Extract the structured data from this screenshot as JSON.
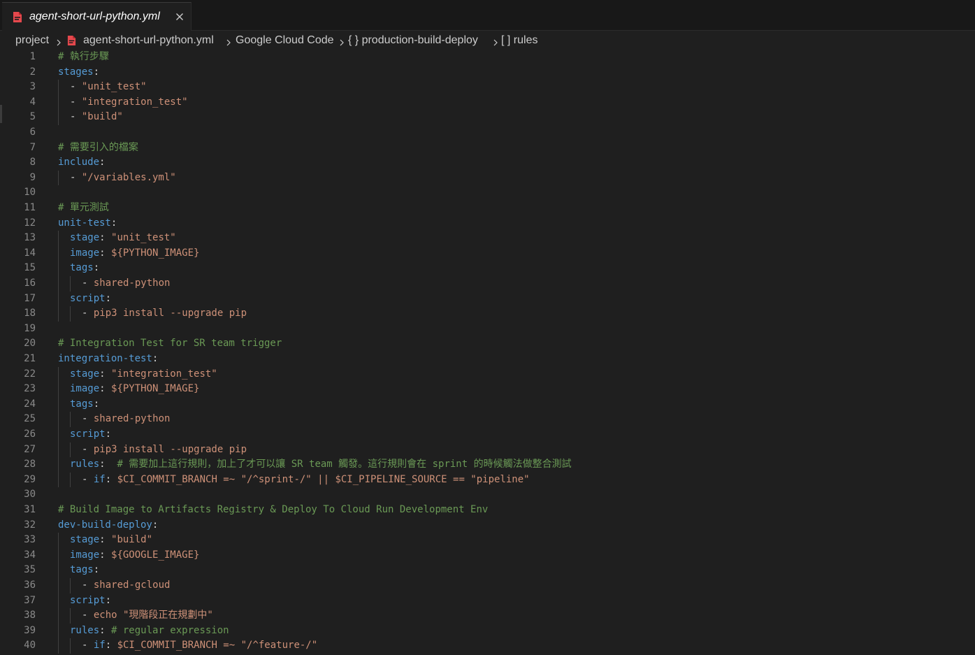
{
  "tab": {
    "title": "agent-short-url-python.yml",
    "icon": "yaml-file-icon",
    "icon_color": "#e5484d"
  },
  "breadcrumb": {
    "items": [
      {
        "label": "project"
      },
      {
        "label": "agent-short-url-python.yml"
      },
      {
        "label": "Google Cloud Code"
      },
      {
        "label": "{ } production-build-deploy"
      },
      {
        "label": "[ ] rules"
      }
    ]
  },
  "colors": {
    "keyword": "#569cd6",
    "string": "#ce9178",
    "comment": "#6a9955",
    "punctuation": "#d4d4d4",
    "line_number": "#8a8a8a"
  },
  "editor": {
    "lines": [
      {
        "n": "1",
        "indent": 0,
        "tokens": [
          {
            "c": "c",
            "t": "# 執行步驟"
          }
        ]
      },
      {
        "n": "2",
        "indent": 0,
        "tokens": [
          {
            "c": "k",
            "t": "stages"
          },
          {
            "c": "p",
            "t": ":"
          }
        ]
      },
      {
        "n": "3",
        "indent": 1,
        "tokens": [
          {
            "c": "p",
            "t": "- "
          },
          {
            "c": "s",
            "t": "\"unit_test\""
          }
        ]
      },
      {
        "n": "4",
        "indent": 1,
        "tokens": [
          {
            "c": "p",
            "t": "- "
          },
          {
            "c": "s",
            "t": "\"integration_test\""
          }
        ]
      },
      {
        "n": "5",
        "indent": 1,
        "tokens": [
          {
            "c": "p",
            "t": "- "
          },
          {
            "c": "s",
            "t": "\"build\""
          }
        ]
      },
      {
        "n": "6",
        "indent": 0,
        "tokens": []
      },
      {
        "n": "7",
        "indent": 0,
        "tokens": [
          {
            "c": "c",
            "t": "# 需要引入的檔案"
          }
        ]
      },
      {
        "n": "8",
        "indent": 0,
        "tokens": [
          {
            "c": "k",
            "t": "include"
          },
          {
            "c": "p",
            "t": ":"
          }
        ]
      },
      {
        "n": "9",
        "indent": 1,
        "tokens": [
          {
            "c": "p",
            "t": "- "
          },
          {
            "c": "s",
            "t": "\"/variables.yml\""
          }
        ]
      },
      {
        "n": "10",
        "indent": 0,
        "tokens": []
      },
      {
        "n": "11",
        "indent": 0,
        "tokens": [
          {
            "c": "c",
            "t": "# 單元測試"
          }
        ]
      },
      {
        "n": "12",
        "indent": 0,
        "tokens": [
          {
            "c": "k",
            "t": "unit-test"
          },
          {
            "c": "p",
            "t": ":"
          }
        ]
      },
      {
        "n": "13",
        "indent": 1,
        "tokens": [
          {
            "c": "k",
            "t": "stage"
          },
          {
            "c": "p",
            "t": ": "
          },
          {
            "c": "s",
            "t": "\"unit_test\""
          }
        ]
      },
      {
        "n": "14",
        "indent": 1,
        "tokens": [
          {
            "c": "k",
            "t": "image"
          },
          {
            "c": "p",
            "t": ": "
          },
          {
            "c": "s",
            "t": "${PYTHON_IMAGE}"
          }
        ]
      },
      {
        "n": "15",
        "indent": 1,
        "tokens": [
          {
            "c": "k",
            "t": "tags"
          },
          {
            "c": "p",
            "t": ":"
          }
        ]
      },
      {
        "n": "16",
        "indent": 2,
        "tokens": [
          {
            "c": "p",
            "t": "- "
          },
          {
            "c": "s",
            "t": "shared-python"
          }
        ]
      },
      {
        "n": "17",
        "indent": 1,
        "tokens": [
          {
            "c": "k",
            "t": "script"
          },
          {
            "c": "p",
            "t": ":"
          }
        ]
      },
      {
        "n": "18",
        "indent": 2,
        "tokens": [
          {
            "c": "p",
            "t": "- "
          },
          {
            "c": "s",
            "t": "pip3 install --upgrade pip"
          }
        ]
      },
      {
        "n": "19",
        "indent": 0,
        "tokens": []
      },
      {
        "n": "20",
        "indent": 0,
        "tokens": [
          {
            "c": "c",
            "t": "# Integration Test for SR team trigger"
          }
        ]
      },
      {
        "n": "21",
        "indent": 0,
        "tokens": [
          {
            "c": "k",
            "t": "integration-test"
          },
          {
            "c": "p",
            "t": ":"
          }
        ]
      },
      {
        "n": "22",
        "indent": 1,
        "tokens": [
          {
            "c": "k",
            "t": "stage"
          },
          {
            "c": "p",
            "t": ": "
          },
          {
            "c": "s",
            "t": "\"integration_test\""
          }
        ]
      },
      {
        "n": "23",
        "indent": 1,
        "tokens": [
          {
            "c": "k",
            "t": "image"
          },
          {
            "c": "p",
            "t": ": "
          },
          {
            "c": "s",
            "t": "${PYTHON_IMAGE}"
          }
        ]
      },
      {
        "n": "24",
        "indent": 1,
        "tokens": [
          {
            "c": "k",
            "t": "tags"
          },
          {
            "c": "p",
            "t": ":"
          }
        ]
      },
      {
        "n": "25",
        "indent": 2,
        "tokens": [
          {
            "c": "p",
            "t": "- "
          },
          {
            "c": "s",
            "t": "shared-python"
          }
        ]
      },
      {
        "n": "26",
        "indent": 1,
        "tokens": [
          {
            "c": "k",
            "t": "script"
          },
          {
            "c": "p",
            "t": ":"
          }
        ]
      },
      {
        "n": "27",
        "indent": 2,
        "tokens": [
          {
            "c": "p",
            "t": "- "
          },
          {
            "c": "s",
            "t": "pip3 install --upgrade pip"
          }
        ]
      },
      {
        "n": "28",
        "indent": 1,
        "tokens": [
          {
            "c": "k",
            "t": "rules"
          },
          {
            "c": "p",
            "t": ":  "
          },
          {
            "c": "c",
            "t": "# 需要加上這行規則，加上了才可以讓 SR team 觸發。這行規則會在 sprint 的時候觸法做整合測試"
          }
        ]
      },
      {
        "n": "29",
        "indent": 2,
        "tokens": [
          {
            "c": "p",
            "t": "- "
          },
          {
            "c": "k",
            "t": "if"
          },
          {
            "c": "p",
            "t": ": "
          },
          {
            "c": "s",
            "t": "$CI_COMMIT_BRANCH =~ \"/^sprint-/\" || $CI_PIPELINE_SOURCE == \"pipeline\""
          }
        ]
      },
      {
        "n": "30",
        "indent": 0,
        "tokens": []
      },
      {
        "n": "31",
        "indent": 0,
        "tokens": [
          {
            "c": "c",
            "t": "# Build Image to Artifacts Registry & Deploy To Cloud Run Development Env"
          }
        ]
      },
      {
        "n": "32",
        "indent": 0,
        "tokens": [
          {
            "c": "k",
            "t": "dev-build-deploy"
          },
          {
            "c": "p",
            "t": ":"
          }
        ]
      },
      {
        "n": "33",
        "indent": 1,
        "tokens": [
          {
            "c": "k",
            "t": "stage"
          },
          {
            "c": "p",
            "t": ": "
          },
          {
            "c": "s",
            "t": "\"build\""
          }
        ]
      },
      {
        "n": "34",
        "indent": 1,
        "tokens": [
          {
            "c": "k",
            "t": "image"
          },
          {
            "c": "p",
            "t": ": "
          },
          {
            "c": "s",
            "t": "${GOOGLE_IMAGE}"
          }
        ]
      },
      {
        "n": "35",
        "indent": 1,
        "tokens": [
          {
            "c": "k",
            "t": "tags"
          },
          {
            "c": "p",
            "t": ":"
          }
        ]
      },
      {
        "n": "36",
        "indent": 2,
        "tokens": [
          {
            "c": "p",
            "t": "- "
          },
          {
            "c": "s",
            "t": "shared-gcloud"
          }
        ]
      },
      {
        "n": "37",
        "indent": 1,
        "tokens": [
          {
            "c": "k",
            "t": "script"
          },
          {
            "c": "p",
            "t": ":"
          }
        ]
      },
      {
        "n": "38",
        "indent": 2,
        "tokens": [
          {
            "c": "p",
            "t": "- "
          },
          {
            "c": "s",
            "t": "echo \"現階段正在規劃中\""
          }
        ]
      },
      {
        "n": "39",
        "indent": 1,
        "tokens": [
          {
            "c": "k",
            "t": "rules"
          },
          {
            "c": "p",
            "t": ": "
          },
          {
            "c": "c",
            "t": "# regular expression"
          }
        ]
      },
      {
        "n": "40",
        "indent": 2,
        "tokens": [
          {
            "c": "p",
            "t": "- "
          },
          {
            "c": "k",
            "t": "if"
          },
          {
            "c": "p",
            "t": ": "
          },
          {
            "c": "s",
            "t": "$CI_COMMIT_BRANCH =~ \"/^feature-/\""
          }
        ]
      }
    ]
  }
}
